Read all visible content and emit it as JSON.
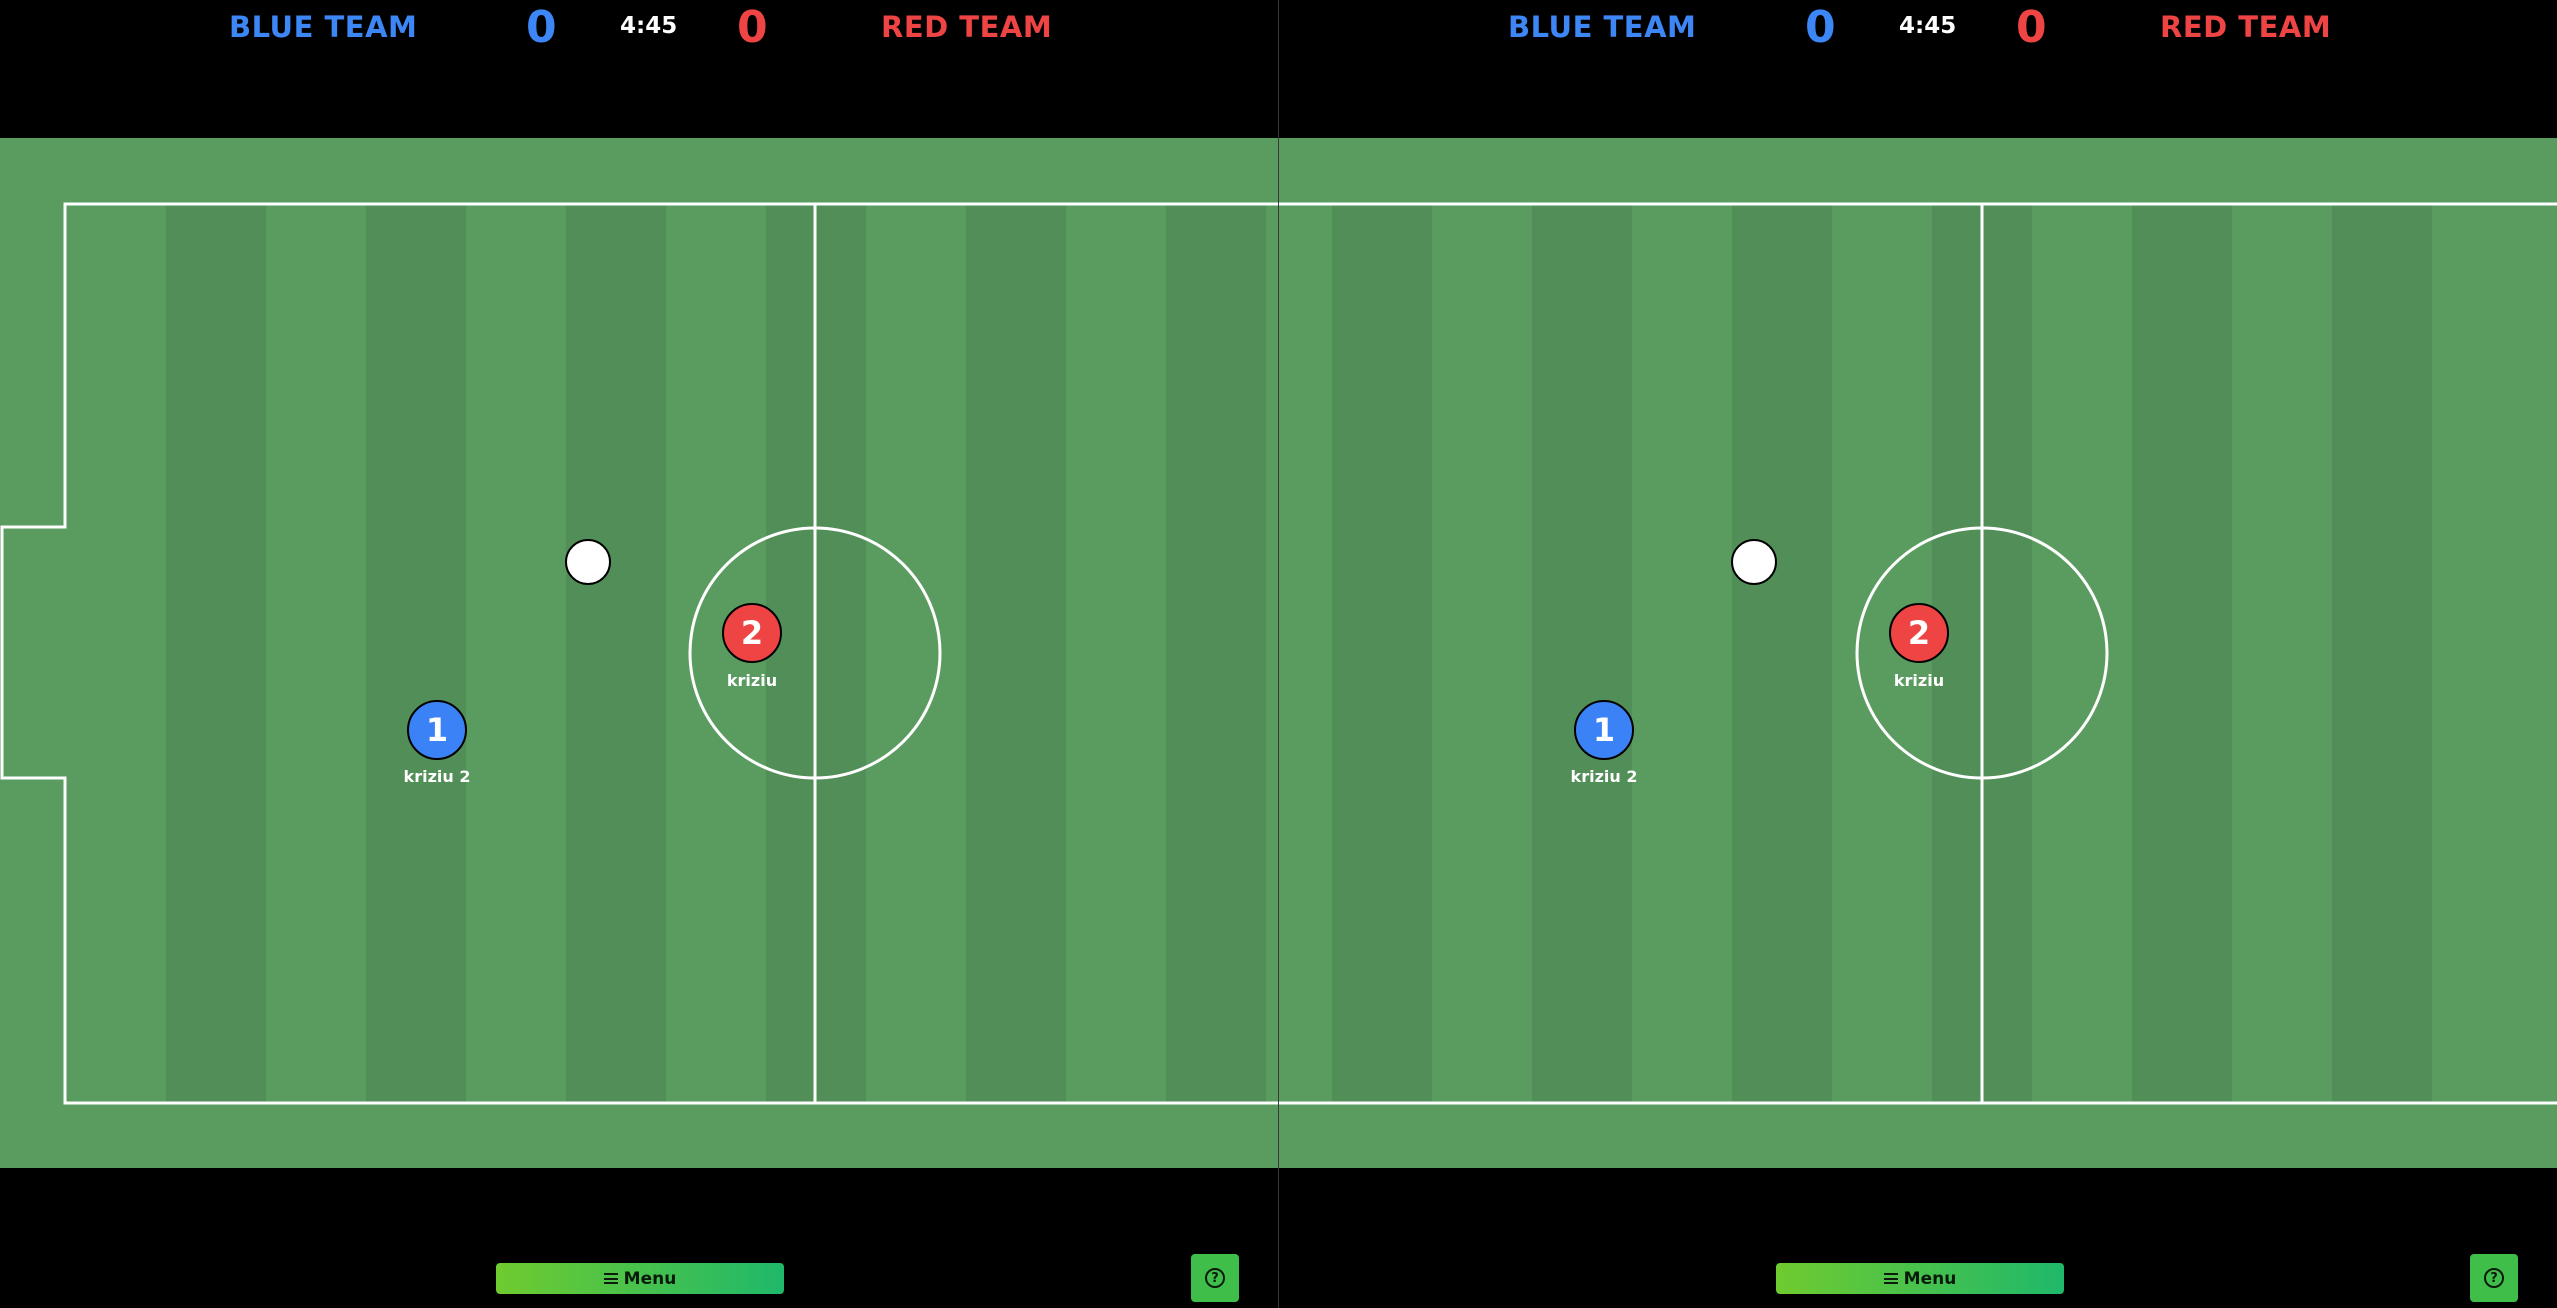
{
  "panes": [
    {
      "blue_team": "BLUE TEAM",
      "red_team": "RED TEAM",
      "blue_score": "0",
      "red_score": "0",
      "timer": "4:45",
      "players": [
        {
          "number": "1",
          "name": "kriziu 2",
          "team": "blue"
        },
        {
          "number": "2",
          "name": "kriziu",
          "team": "red"
        }
      ],
      "menu_label": "Menu",
      "help_icon": "question-circle-icon",
      "menu_icon": "hamburger-icon"
    },
    {
      "blue_team": "BLUE TEAM",
      "red_team": "RED TEAM",
      "blue_score": "0",
      "red_score": "0",
      "timer": "4:45",
      "players": [
        {
          "number": "1",
          "name": "kriziu 2",
          "team": "blue"
        },
        {
          "number": "2",
          "name": "kriziu",
          "team": "red"
        }
      ],
      "menu_label": "Menu",
      "help_icon": "question-circle-icon",
      "menu_icon": "hamburger-icon"
    }
  ],
  "colors": {
    "blue": "#3b82f6",
    "red": "#ef4444",
    "grass_light": "#5a9c60",
    "grass_dark": "#528e57",
    "button_gradient_start": "#6fcb2f",
    "button_gradient_end": "#1fb86a"
  }
}
